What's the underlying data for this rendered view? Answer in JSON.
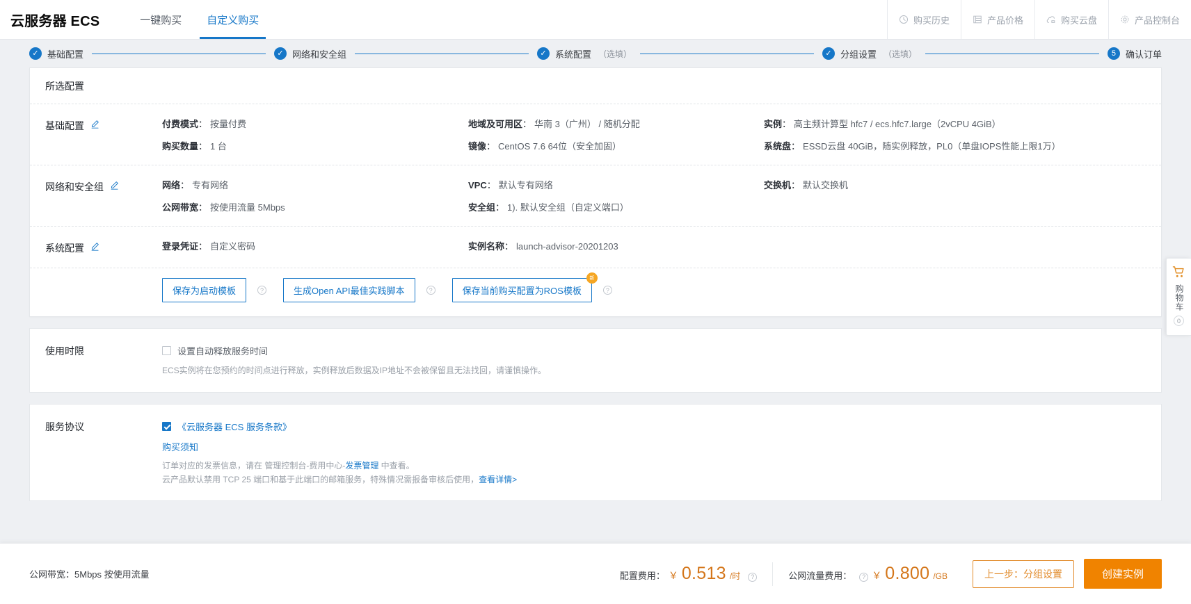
{
  "header": {
    "brand": "云服务器 ECS",
    "tabs": [
      {
        "label": "一键购买",
        "active": false
      },
      {
        "label": "自定义购买",
        "active": true
      }
    ],
    "actions": [
      {
        "label": "购买历史",
        "icon": "clock-icon"
      },
      {
        "label": "产品价格",
        "icon": "list-icon"
      },
      {
        "label": "购买云盘",
        "icon": "disk-icon"
      },
      {
        "label": "产品控制台",
        "icon": "gear-icon"
      }
    ]
  },
  "steps": [
    {
      "label": "基础配置",
      "optional": "",
      "state": "done",
      "marker": "✓"
    },
    {
      "label": "网络和安全组",
      "optional": "",
      "state": "done",
      "marker": "✓"
    },
    {
      "label": "系统配置",
      "optional": "（选填）",
      "state": "done",
      "marker": "✓"
    },
    {
      "label": "分组设置",
      "optional": "（选填）",
      "state": "done",
      "marker": "✓"
    },
    {
      "label": "确认订单",
      "optional": "",
      "state": "current",
      "marker": "5"
    }
  ],
  "card": {
    "title": "所选配置",
    "sections": [
      {
        "title": "基础配置",
        "col1": [
          {
            "k": "付费模式",
            "v": "按量付费"
          },
          {
            "k": "购买数量",
            "v": "1 台"
          }
        ],
        "col2": [
          {
            "k": "地域及可用区",
            "v": "华南 3（广州） / 随机分配"
          },
          {
            "k": "镜像",
            "v": "CentOS 7.6 64位（安全加固）"
          }
        ],
        "col3": [
          {
            "k": "实例",
            "v": "高主频计算型 hfc7 / ecs.hfc7.large（2vCPU 4GiB）"
          },
          {
            "k": "系统盘",
            "v": "ESSD云盘 40GiB，随实例释放，PL0（单盘IOPS性能上限1万）"
          }
        ]
      },
      {
        "title": "网络和安全组",
        "col1": [
          {
            "k": "网络",
            "v": "专有网络"
          },
          {
            "k": "公网带宽",
            "v": "按使用流量 5Mbps"
          }
        ],
        "col2": [
          {
            "k": "VPC",
            "v": "默认专有网络"
          },
          {
            "k": "安全组",
            "v": "1). 默认安全组（自定义端口）"
          }
        ],
        "col3": [
          {
            "k": "交换机",
            "v": "默认交换机"
          }
        ]
      },
      {
        "title": "系统配置",
        "col1": [
          {
            "k": "登录凭证",
            "v": "自定义密码"
          }
        ],
        "col2": [
          {
            "k": "实例名称",
            "v": "launch-advisor-20201203"
          }
        ],
        "col3": []
      }
    ],
    "template_buttons": [
      {
        "label": "保存为启动模板",
        "badge": ""
      },
      {
        "label": "生成Open API最佳实践脚本",
        "badge": ""
      },
      {
        "label": "保存当前购买配置为ROS模板",
        "badge": "新"
      }
    ]
  },
  "usage": {
    "title": "使用时限",
    "checkbox_label": "设置自动释放服务时间",
    "checked": false,
    "note": "ECS实例将在您预约的时间点进行释放，实例释放后数据及IP地址不会被保留且无法找回，请谨慎操作。"
  },
  "agreement": {
    "title": "服务协议",
    "checked": true,
    "terms_link": "《云服务器 ECS 服务条款》",
    "notice_link": "购买须知",
    "line1_prefix": "订单对应的发票信息，请在 管理控制台-费用中心-",
    "line1_link": "发票管理",
    "line1_suffix": " 中查看。",
    "line2_prefix": "云产品默认禁用 TCP 25 端口和基于此端口的邮箱服务，特殊情况需报备审核后使用，",
    "line2_link": "查看详情>"
  },
  "cart": {
    "label": "购物车",
    "count": "0"
  },
  "footer": {
    "bandwidth_label": "公网带宽：",
    "bandwidth_value": "5Mbps 按使用流量",
    "config_fee_label": "配置费用：",
    "config_currency": "￥",
    "config_price": "0.513",
    "config_unit": "/时",
    "traffic_fee_label": "公网流量费用：",
    "traffic_currency": "￥",
    "traffic_price": "0.800",
    "traffic_unit": "/GB",
    "prev_button": "上一步：分组设置",
    "create_button": "创建实例"
  },
  "colors": {
    "accent": "#1677c8",
    "price": "#d4761a",
    "cta": "#f08300"
  }
}
